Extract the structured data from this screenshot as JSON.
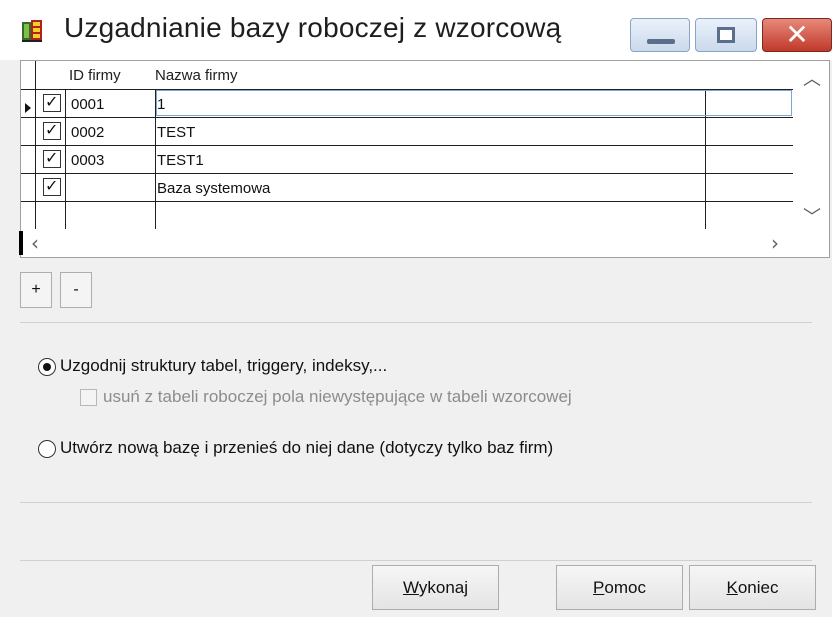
{
  "window": {
    "title": "Uzgadnianie bazy roboczej z wzorcową",
    "icon": "database-app-icon"
  },
  "grid": {
    "columns": [
      "ID firmy",
      "Nazwa firmy"
    ],
    "rows": [
      {
        "checked": true,
        "id": "0001",
        "name": "1",
        "current": true
      },
      {
        "checked": true,
        "id": "0002",
        "name": "TEST",
        "current": false
      },
      {
        "checked": true,
        "id": "0003",
        "name": "TEST1",
        "current": false
      },
      {
        "checked": true,
        "id": "",
        "name": "Baza systemowa",
        "current": false
      }
    ]
  },
  "row_buttons": {
    "add": "+",
    "remove": "-"
  },
  "options": {
    "sync": {
      "label": "Uzgodnij struktury tabel, triggery, indeksy,...",
      "selected": true
    },
    "remove_fields": {
      "label": "usuń z tabeli roboczej pola niewystępujące w tabeli wzorcowej",
      "checked": false,
      "disabled": true
    },
    "new_db": {
      "label": "Utwórz nową bazę i przenieś do niej dane (dotyczy tylko baz firm)",
      "selected": false
    }
  },
  "buttons": {
    "execute": {
      "mnemonic": "W",
      "rest": "ykonaj"
    },
    "help": {
      "mnemonic": "P",
      "rest": "omoc"
    },
    "end": {
      "mnemonic": "K",
      "rest": "oniec"
    }
  }
}
